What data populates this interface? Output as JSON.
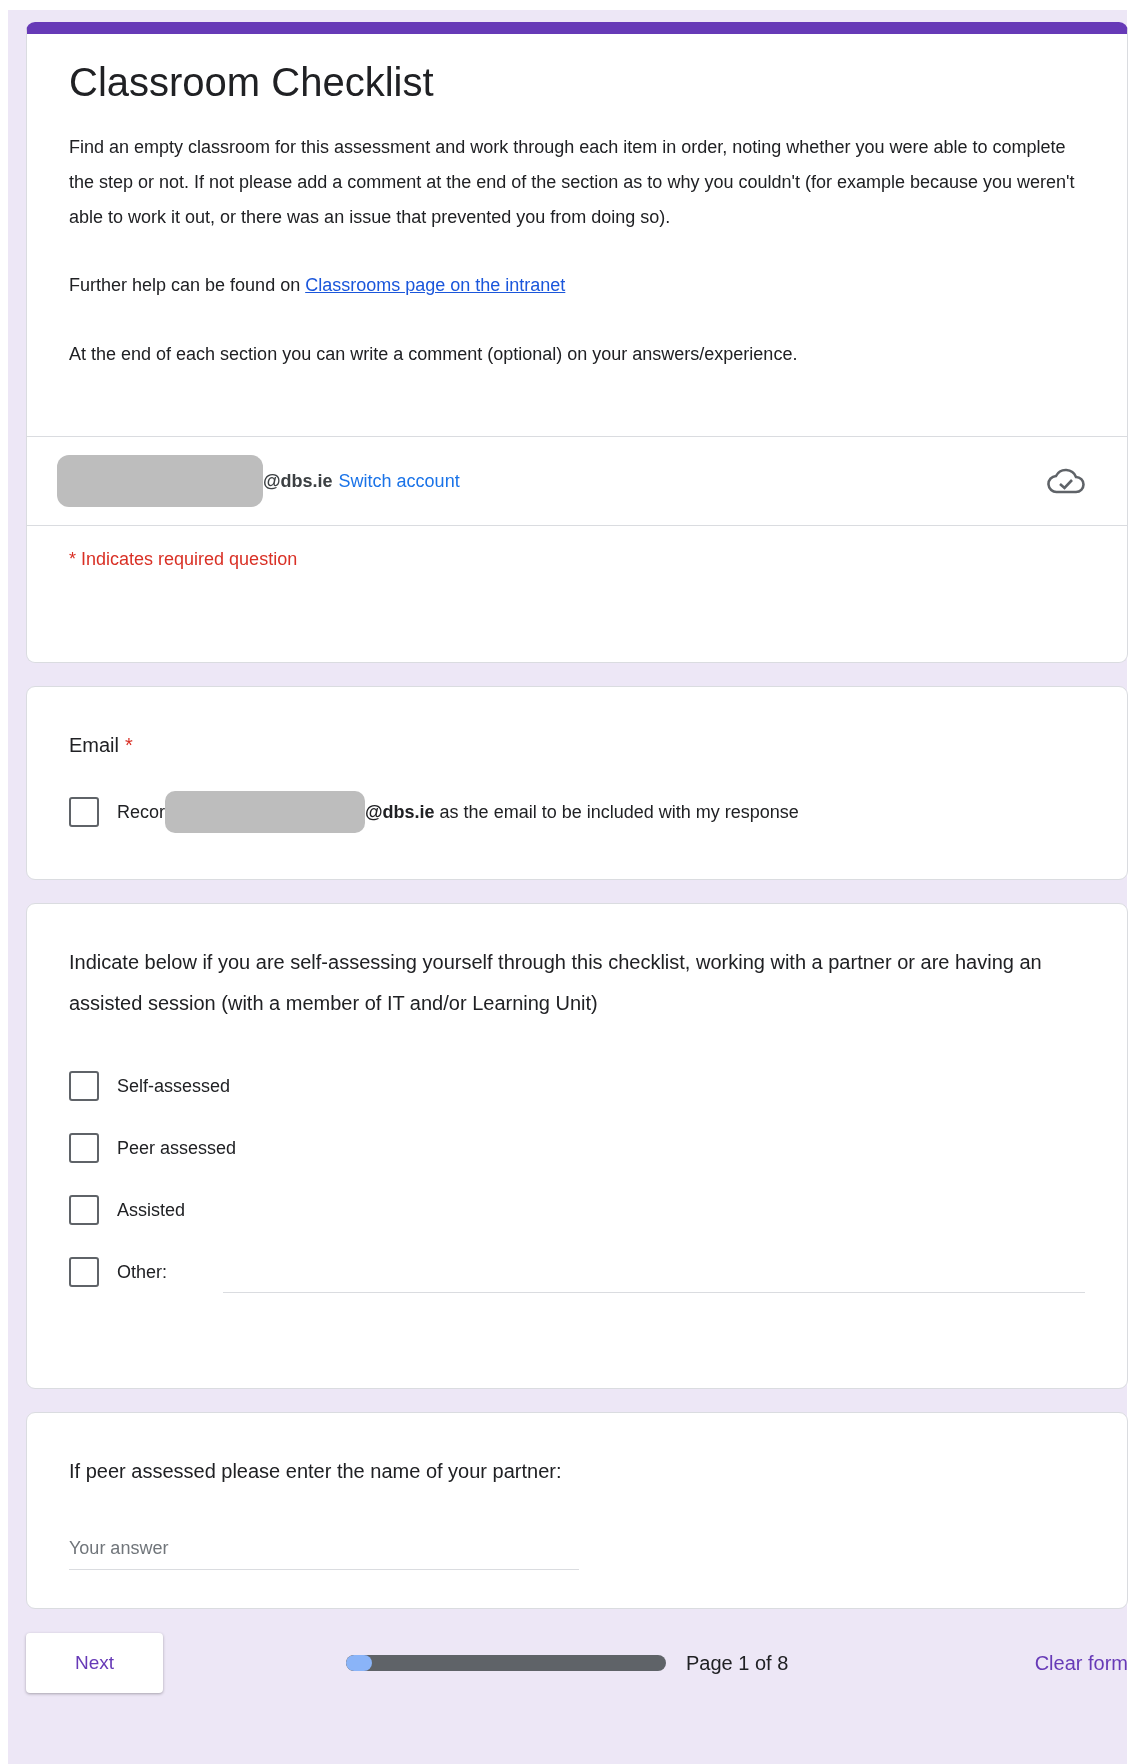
{
  "header": {
    "title": "Classroom Checklist",
    "description": "Find an empty classroom for this assessment and work through each item in order, noting whether you were able to complete the step or not.  If not please add a comment at the end of the section as to why you couldn't (for example because you weren't able to work it out, or there was an issue that prevented you from doing so).",
    "help_text": "Further help can be found on ",
    "help_link": "Classrooms page on the intranet",
    "note": "At the end of each section you can write a comment (optional) on your answers/experience.",
    "account": {
      "domain": "@dbs.ie",
      "switch_link": "Switch account"
    },
    "required_note": "* Indicates required question"
  },
  "email_question": {
    "label": "Email",
    "required_mark": "*",
    "option": {
      "prefix": "Recor",
      "suffix": "@dbs.ie",
      "rest": " as the email to be included with my response",
      "checked": false
    }
  },
  "mode_question": {
    "label": "Indicate below if you are self-assessing yourself through this checklist, working with a partner or are having an assisted session (with a member of IT and/or Learning Unit)",
    "options": [
      {
        "kind": "plain",
        "label": "Self-assessed",
        "checked": false
      },
      {
        "kind": "plain",
        "label": "Peer assessed",
        "checked": false
      },
      {
        "kind": "plain",
        "label": "Assisted",
        "checked": false
      },
      {
        "kind": "other",
        "label": "Other:",
        "checked": false
      }
    ]
  },
  "partner_question": {
    "label": "If peer assessed please enter the name of your partner:",
    "placeholder": "Your answer"
  },
  "footer": {
    "next_button": "Next",
    "progress": {
      "level": 0.08
    },
    "page_label": "Page 1 of 8",
    "clear_button": "Clear form"
  }
}
